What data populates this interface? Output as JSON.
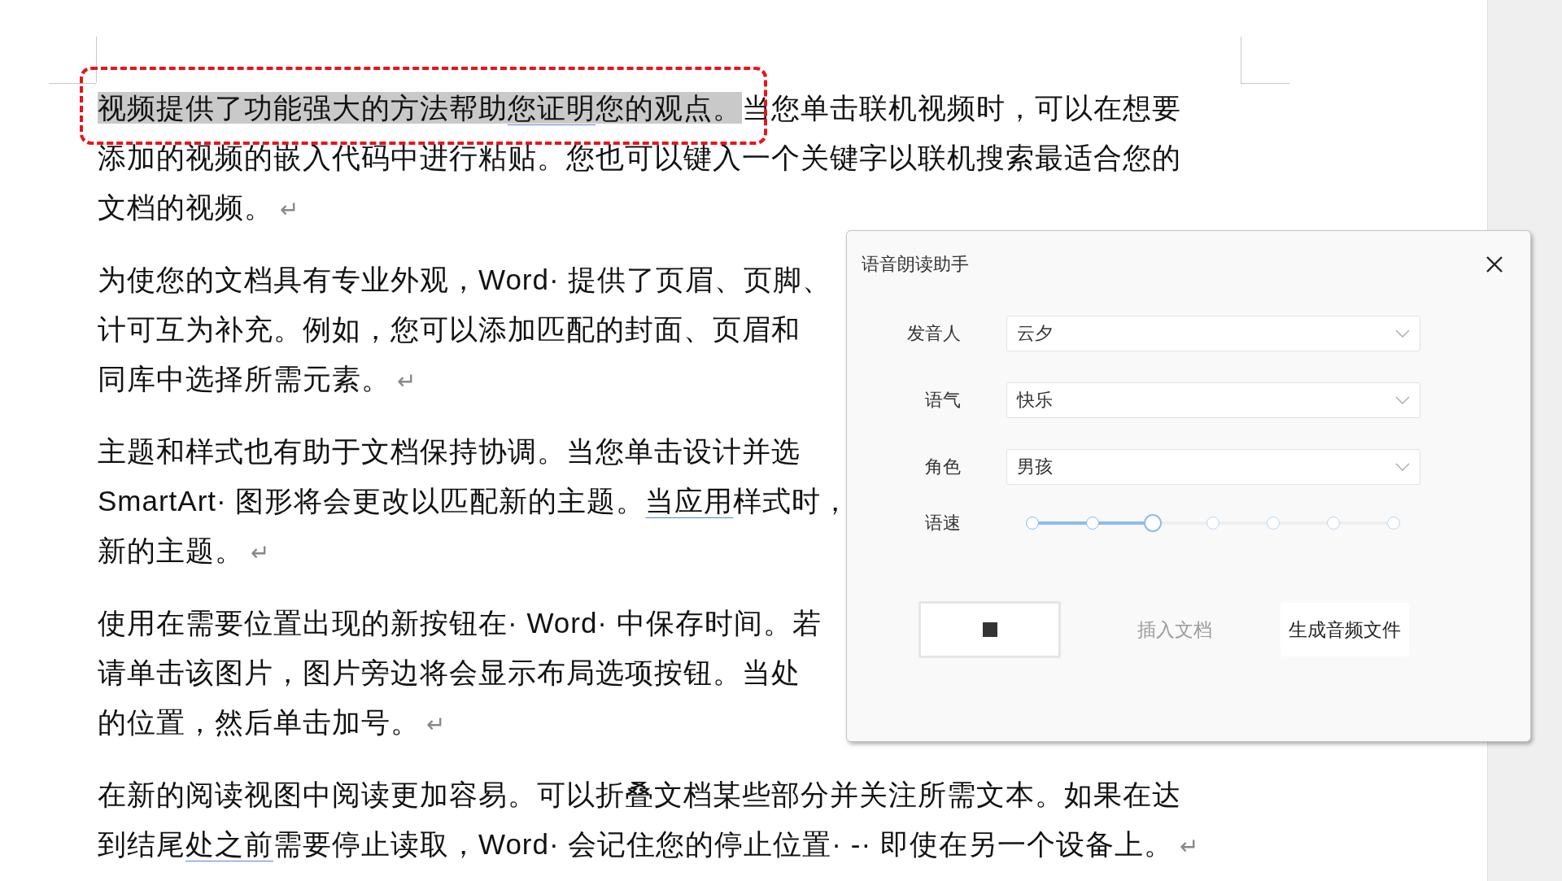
{
  "document": {
    "paragraphs": [
      {
        "lines": [
          [
            {
              "text": "视频提供了功能强大的方法帮助",
              "kind": "highlight"
            },
            {
              "text": "您证明",
              "kind": "highlight-underline"
            },
            {
              "text": "您的观点。",
              "kind": "highlight"
            },
            {
              "text": "当您单击联机视频时，可以在想要",
              "kind": "plain"
            }
          ],
          [
            {
              "text": "添加的视频的嵌入代码中进行粘贴。您也可以键入一个关键字以联机搜索最适合您的",
              "kind": "plain"
            }
          ],
          [
            {
              "text": "文档的视频。",
              "kind": "plain"
            },
            {
              "text": "↵",
              "kind": "mark"
            }
          ]
        ]
      },
      {
        "lines": [
          [
            {
              "text": "为使您的文档具有专业外观，Word· 提供了页眉、页脚、",
              "kind": "plain"
            }
          ],
          [
            {
              "text": "计可互为补充。例如，您可以添加匹配的封面、页眉和",
              "kind": "plain"
            }
          ],
          [
            {
              "text": "同库中选择所需元素。",
              "kind": "plain"
            },
            {
              "text": "↵",
              "kind": "mark"
            }
          ]
        ]
      },
      {
        "lines": [
          [
            {
              "text": "主题和样式也有助于文档保持协调。当您单击设计并选",
              "kind": "plain"
            }
          ],
          [
            {
              "text": "SmartArt· 图形将会更改以匹配新的主题。",
              "kind": "plain"
            },
            {
              "text": "当应用",
              "kind": "underline"
            },
            {
              "text": "样式时，",
              "kind": "plain"
            }
          ],
          [
            {
              "text": "新的主题。",
              "kind": "plain"
            },
            {
              "text": "↵",
              "kind": "mark"
            }
          ]
        ]
      },
      {
        "lines": [
          [
            {
              "text": "使用在需要位置出现的新按钮在· Word· 中保存时间。若",
              "kind": "plain"
            }
          ],
          [
            {
              "text": "请单击该图片，图片旁边将会显示布局选项按钮。当处",
              "kind": "plain"
            }
          ],
          [
            {
              "text": "的位置，然后单击加号。",
              "kind": "plain"
            },
            {
              "text": "↵",
              "kind": "mark"
            }
          ]
        ]
      },
      {
        "lines": [
          [
            {
              "text": "在新的阅读视图中阅读更加容易。可以折叠文档某些部分并关注所需文本。如果在达",
              "kind": "plain"
            }
          ],
          [
            {
              "text": "到结尾",
              "kind": "plain"
            },
            {
              "text": "处之前",
              "kind": "underline"
            },
            {
              "text": "需要停止读取，Word· 会记住您的停止位置· -· 即使在另一个设备上。",
              "kind": "plain"
            },
            {
              "text": "↵",
              "kind": "mark"
            }
          ]
        ]
      }
    ]
  },
  "dialog": {
    "title": "语音朗读助手",
    "fields": [
      {
        "label": "发音人",
        "value": "云夕"
      },
      {
        "label": "语气",
        "value": "快乐"
      },
      {
        "label": "角色",
        "value": "男孩"
      }
    ],
    "speed": {
      "label": "语速",
      "level": 0.3333
    },
    "buttons": [
      {
        "kind": "stop",
        "disabled": false
      },
      {
        "kind": "text",
        "label": "插入文档",
        "disabled": true
      },
      {
        "kind": "text",
        "label": "生成音频文件",
        "disabled": false
      }
    ]
  }
}
